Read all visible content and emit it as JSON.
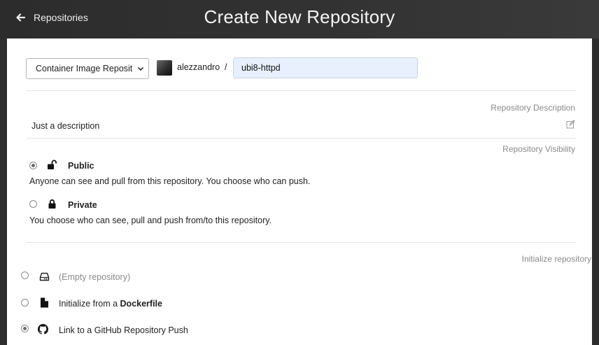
{
  "header": {
    "back_label": "Repositories",
    "title": "Create New Repository"
  },
  "form": {
    "repo_kind_selected": "Container Image Reposit",
    "namespace": "alezzandro",
    "separator": "/",
    "repo_name": "ubi8-httpd"
  },
  "description": {
    "label": "Repository Description",
    "value": "Just a description"
  },
  "visibility": {
    "label": "Repository Visibility",
    "options": [
      {
        "title": "Public",
        "description": "Anyone can see and pull from this repository. You choose who can push.",
        "checked": true,
        "icon": "unlock-icon"
      },
      {
        "title": "Private",
        "description": "You choose who can see, pull and push from/to this repository.",
        "checked": false,
        "icon": "lock-icon"
      }
    ]
  },
  "initialize": {
    "label": "Initialize repository",
    "options": [
      {
        "prefix": "(Empty repository)",
        "emphasis": "",
        "checked": false,
        "icon": "hard-drive-icon"
      },
      {
        "prefix": "Initialize from a ",
        "emphasis": "Dockerfile",
        "checked": false,
        "icon": "file-icon"
      },
      {
        "prefix": "Link to a GitHub Repository Push",
        "emphasis": "",
        "checked": true,
        "icon": "github-icon"
      }
    ]
  }
}
